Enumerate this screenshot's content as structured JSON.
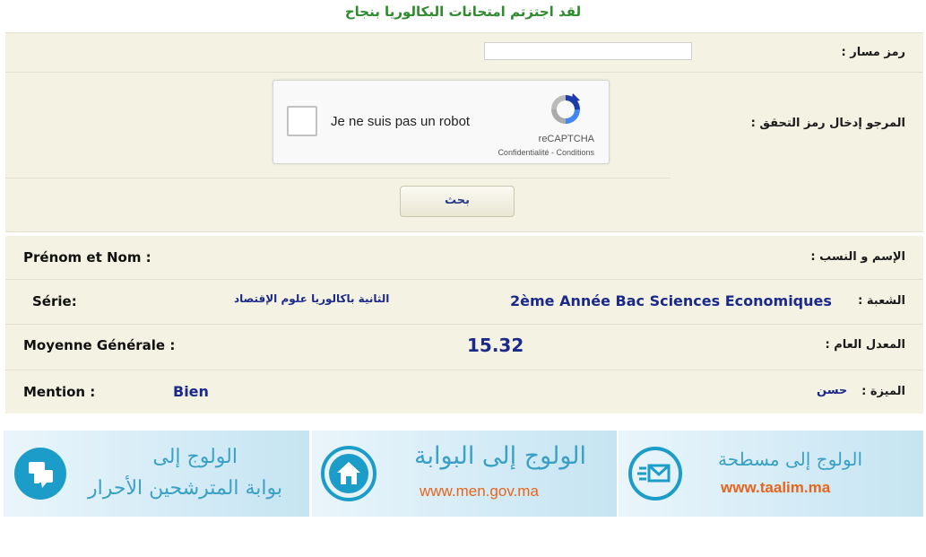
{
  "header": {
    "congrats": "لقد اجتزتم امتحانات البكالوريا بنجاح"
  },
  "form": {
    "code_label": "رمز مسار :",
    "code_value": "",
    "captcha_label": "المرجو إدخال رمز التحقق :",
    "captcha": {
      "checkbox_text": "Je ne suis pas un robot",
      "brand": "reCAPTCHA",
      "links": "Confidentialité - Conditions"
    },
    "search_button": "بحث"
  },
  "results": {
    "name": {
      "label_fr": "Prénom et Nom :",
      "label_ar": "الإسم و النسب :"
    },
    "serie": {
      "label_fr": "Série:",
      "value_ar": "الثانية باكالوريا علوم الإقتصاد",
      "value_fr": "2ème Année Bac Sciences Economiques",
      "label_ar": "الشعبة :"
    },
    "average": {
      "label_fr": "Moyenne Générale :",
      "value": "15.32",
      "label_ar": "المعدل العام :"
    },
    "mention": {
      "label_fr": "Mention :",
      "value_fr": "Bien",
      "value_ar": "حسن",
      "label_ar": "الميزة :"
    }
  },
  "portals": [
    {
      "title": "الولوج إلى",
      "subtitle": "بوابة المترشحين الأحرار",
      "icon": "chat-bubbles-icon"
    },
    {
      "title": "الولوج إلى البوابة",
      "url": "www.men.gov.ma",
      "icon": "home-icon"
    },
    {
      "title": "الولوج إلى مسطحة",
      "url": "www.taalim.ma",
      "icon": "mail-icon"
    }
  ],
  "colors": {
    "panel_bg": "#f4f2e2",
    "congrats_green": "#2e8b2e",
    "value_blue": "#1b2a8a",
    "portal_blue": "#1c9cc8",
    "taalim_orange": "#e8641c"
  }
}
